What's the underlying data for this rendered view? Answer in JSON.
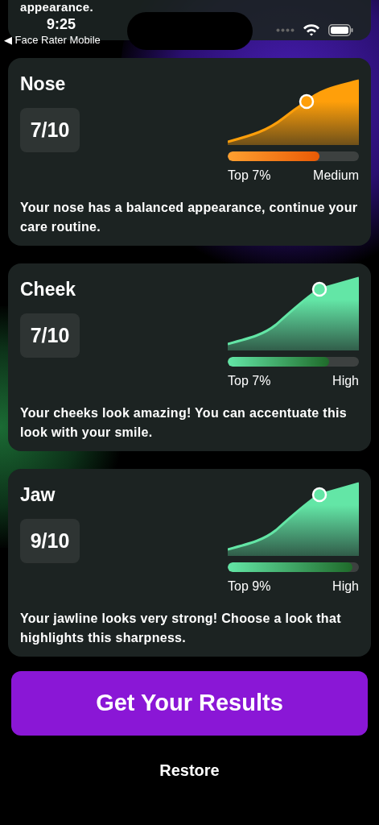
{
  "status_bar": {
    "time": "9:25",
    "back_label": "◀ Face Rater Mobile"
  },
  "previous_card": {
    "description": "appearance."
  },
  "cards": [
    {
      "title": "Nose",
      "score": "7/10",
      "color": "#ff9f0a",
      "level": 0.7,
      "rank": "Top 7%",
      "rating": "Medium",
      "description": "Your nose has a balanced appearance, continue your care routine."
    },
    {
      "title": "Cheek",
      "score": "7/10",
      "color": "#63e6a6",
      "level": 0.77,
      "rank": "Top 7%",
      "rating": "High",
      "description": "Your cheeks look amazing! You can accentuate this look with your smile."
    },
    {
      "title": "Jaw",
      "score": "9/10",
      "color": "#63e6a6",
      "level": 0.95,
      "rank": "Top 9%",
      "rating": "High",
      "description": "Your jawline looks very strong! Choose a look that highlights this sharpness."
    }
  ],
  "primary_button": "Get Your Results",
  "secondary_button": "Restore"
}
